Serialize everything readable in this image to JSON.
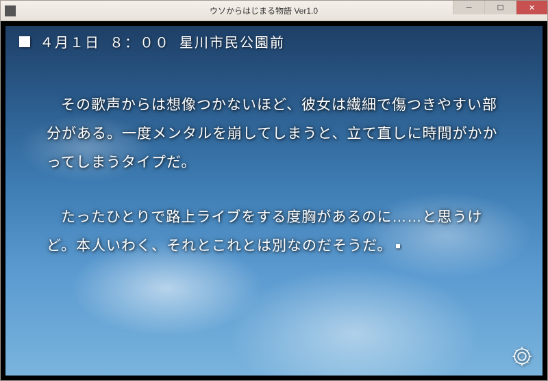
{
  "window": {
    "title": "ウソからはじまる物語  Ver1.0"
  },
  "status": {
    "date": "４月１日",
    "time": "８：００",
    "location": "星川市民公園前"
  },
  "narrative": {
    "p1": "その歌声からは想像つかないほど、彼女は繊細で傷つきやすい部分がある。一度メンタルを崩してしまうと、立て直しに時間がかかってしまうタイプだ。",
    "p2": "たったひとりで路上ライブをする度胸があるのに……と思うけど。本人いわく、それとこれとは別なのだそうだ。"
  },
  "icons": {
    "gear": "settings-gear",
    "app": "app-icon"
  }
}
